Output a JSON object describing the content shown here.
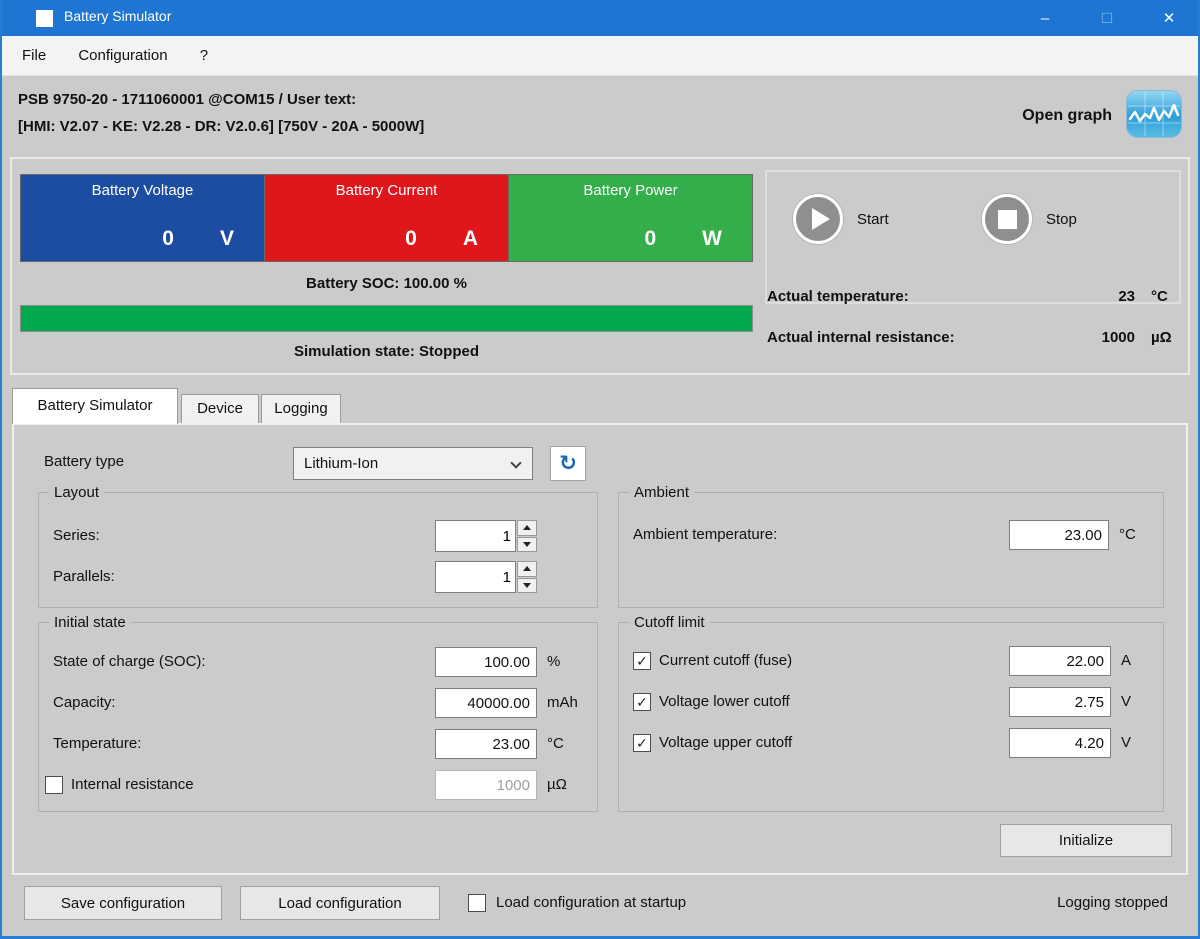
{
  "window": {
    "title": "Battery Simulator"
  },
  "icons": {
    "minimize": "–",
    "maximize": "□",
    "close": "✕",
    "refresh": "↻"
  },
  "menu": {
    "file": "File",
    "configuration": "Configuration",
    "help": "?"
  },
  "device_info": {
    "line1": "PSB 9750-20 - 1711060001 @COM15 / User text:",
    "line2": "[HMI: V2.07 - KE: V2.28 - DR: V2.0.6] [750V - 20A - 5000W]",
    "open_graph": "Open graph"
  },
  "meters": {
    "voltage": {
      "label": "Battery Voltage",
      "value": "0",
      "unit": "V",
      "color": "#1d4da0"
    },
    "current": {
      "label": "Battery Current",
      "value": "0",
      "unit": "A",
      "color": "#e0161d"
    },
    "power": {
      "label": "Battery Power",
      "value": "0",
      "unit": "W",
      "color": "#34ad4b"
    }
  },
  "soc": {
    "text": "Battery SOC: 100.00 %",
    "percent": "100.00",
    "bar_color": "#00a94e"
  },
  "simulation": {
    "text": "Simulation state: Stopped"
  },
  "controls": {
    "start_label": "Start",
    "stop_label": "Stop"
  },
  "actuals": {
    "temperature_label": "Actual temperature:",
    "temperature_value": "23",
    "temperature_unit": "°C",
    "resistance_label": "Actual internal resistance:",
    "resistance_value": "1000",
    "resistance_unit": "µΩ"
  },
  "tabs": [
    {
      "label": "Battery Simulator"
    },
    {
      "label": "Device"
    },
    {
      "label": "Logging"
    }
  ],
  "battery_type": {
    "label": "Battery type",
    "value": "Lithium-Ion"
  },
  "groups": {
    "layout": {
      "title": "Layout",
      "series_label": "Series:",
      "series_value": "1",
      "parallels_label": "Parallels:",
      "parallels_value": "1"
    },
    "ambient": {
      "title": "Ambient",
      "temperature_label": "Ambient temperature:",
      "temperature_value": "23.00",
      "temperature_unit": "°C"
    },
    "initial_state": {
      "title": "Initial state",
      "soc_label": "State of charge (SOC):",
      "soc_value": "100.00",
      "soc_unit": "%",
      "capacity_label": "Capacity:",
      "capacity_value": "40000.00",
      "capacity_unit": "mAh",
      "temperature_label": "Temperature:",
      "temperature_value": "23.00",
      "temperature_unit": "°C",
      "resistance_label": "Internal resistance",
      "resistance_value": "1000",
      "resistance_unit": "µΩ",
      "resistance_checked": false,
      "resistance_mark": ""
    },
    "cutoff": {
      "title": "Cutoff limit",
      "current_label": "Current cutoff (fuse)",
      "current_value": "22.00",
      "current_unit": "A",
      "current_checked": true,
      "current_mark": "✓",
      "lower_label": "Voltage lower cutoff",
      "lower_value": "2.75",
      "lower_unit": "V",
      "lower_checked": true,
      "lower_mark": "✓",
      "upper_label": "Voltage upper cutoff",
      "upper_value": "4.20",
      "upper_unit": "V",
      "upper_checked": true,
      "upper_mark": "✓"
    }
  },
  "buttons": {
    "initialize": "Initialize",
    "save": "Save configuration",
    "load": "Load configuration"
  },
  "footer": {
    "startup_label": "Load configuration at startup",
    "startup_checked": false,
    "startup_mark": "",
    "logging_status": "Logging stopped"
  }
}
